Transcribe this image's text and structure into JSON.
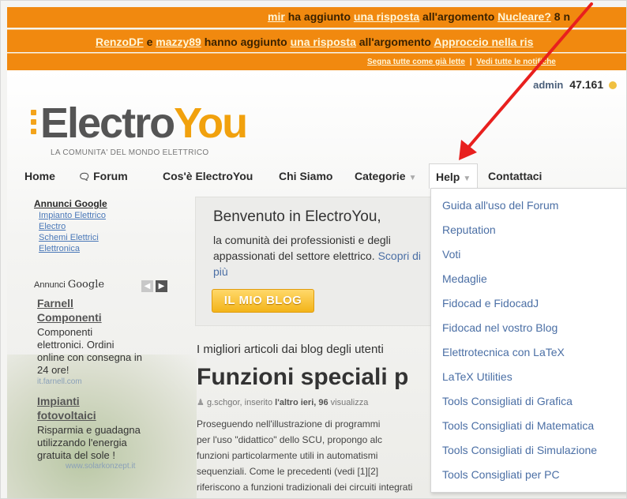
{
  "notifications": {
    "line1": {
      "user": "mir",
      "text1": "ha aggiunto",
      "link": "una risposta",
      "text2": "all'argomento",
      "topic": "Nucleare?",
      "count": "8 n"
    },
    "line2": {
      "user1": "RenzoDF",
      "conj": "e",
      "user2": "mazzy89",
      "text1": "hanno aggiunto",
      "link": "una risposta",
      "text2": "all'argomento",
      "topic": "Approccio nella ris"
    },
    "line3": {
      "mark_read": "Segna tutte come già lette",
      "sep": "|",
      "view_all": "Vedi tutte le notifiche"
    }
  },
  "user": {
    "name": "admin",
    "points": "47.161"
  },
  "logo": {
    "part1": "Electro",
    "part2": "You",
    "tagline": "LA COMUNITA' DEL MONDO ELETTRICO"
  },
  "nav": {
    "home": "Home",
    "forum": "Forum",
    "cos_e": "Cos'è ElectroYou",
    "chi_siamo": "Chi Siamo",
    "categorie": "Categorie",
    "help": "Help",
    "contattaci": "Contattaci"
  },
  "help_menu": [
    "Guida all'uso del Forum",
    "Reputation",
    "Voti",
    "Medaglie",
    "Fidocad e FidocadJ",
    "Fidocad nel vostro Blog",
    "Elettrotecnica con LaTeX",
    "LaTeX Utilities",
    "Tools Consigliati di Grafica",
    "Tools Consigliati di Matematica",
    "Tools Consigliati di Simulazione",
    "Tools Consigliati per PC"
  ],
  "ads": {
    "title": "Annunci Google",
    "links": [
      "Impianto Elettrico",
      "Electro",
      "Schemi Elettrici",
      "Elettronica"
    ],
    "annunci": "Annunci",
    "google": "Google",
    "ad1_title": "Farnell Componenti",
    "ad1_text": [
      "Componenti",
      "elettronici. Ordini",
      "online con consegna in",
      "24 ore!"
    ],
    "ad1_url": "it.farnell.com",
    "ad2_title": "Impianti fotovoltaici",
    "ad2_text": [
      "Risparmia e guadagna",
      "utilizzando l'energia",
      "gratuita del sole !"
    ],
    "ad2_url": "www.solarkonzept.it"
  },
  "welcome": {
    "title": "Benvenuto in ElectroYou,",
    "body": "la comunità dei professionisti e degli appassionati del settore elettrico.",
    "more": "Scopri di più",
    "button": "IL MIO BLOG"
  },
  "articles": {
    "section": "I migliori articoli dai blog degli utenti",
    "title": "Funzioni speciali p",
    "author": "g.schgor",
    "posted": ", inserito",
    "when": "l'altro ieri",
    "views": ", 96",
    "views_label": "visualizza",
    "body": [
      "Proseguendo nell'illustrazione di programmi",
      "per l'uso \"didattico\" dello SCU, propongo alc",
      "funzioni particolarmente utili in automatismi",
      "sequenziali. Come le precedenti (vedi [1][2]",
      "riferiscono a funzioni tradizionali dei circuiti integrati"
    ]
  }
}
